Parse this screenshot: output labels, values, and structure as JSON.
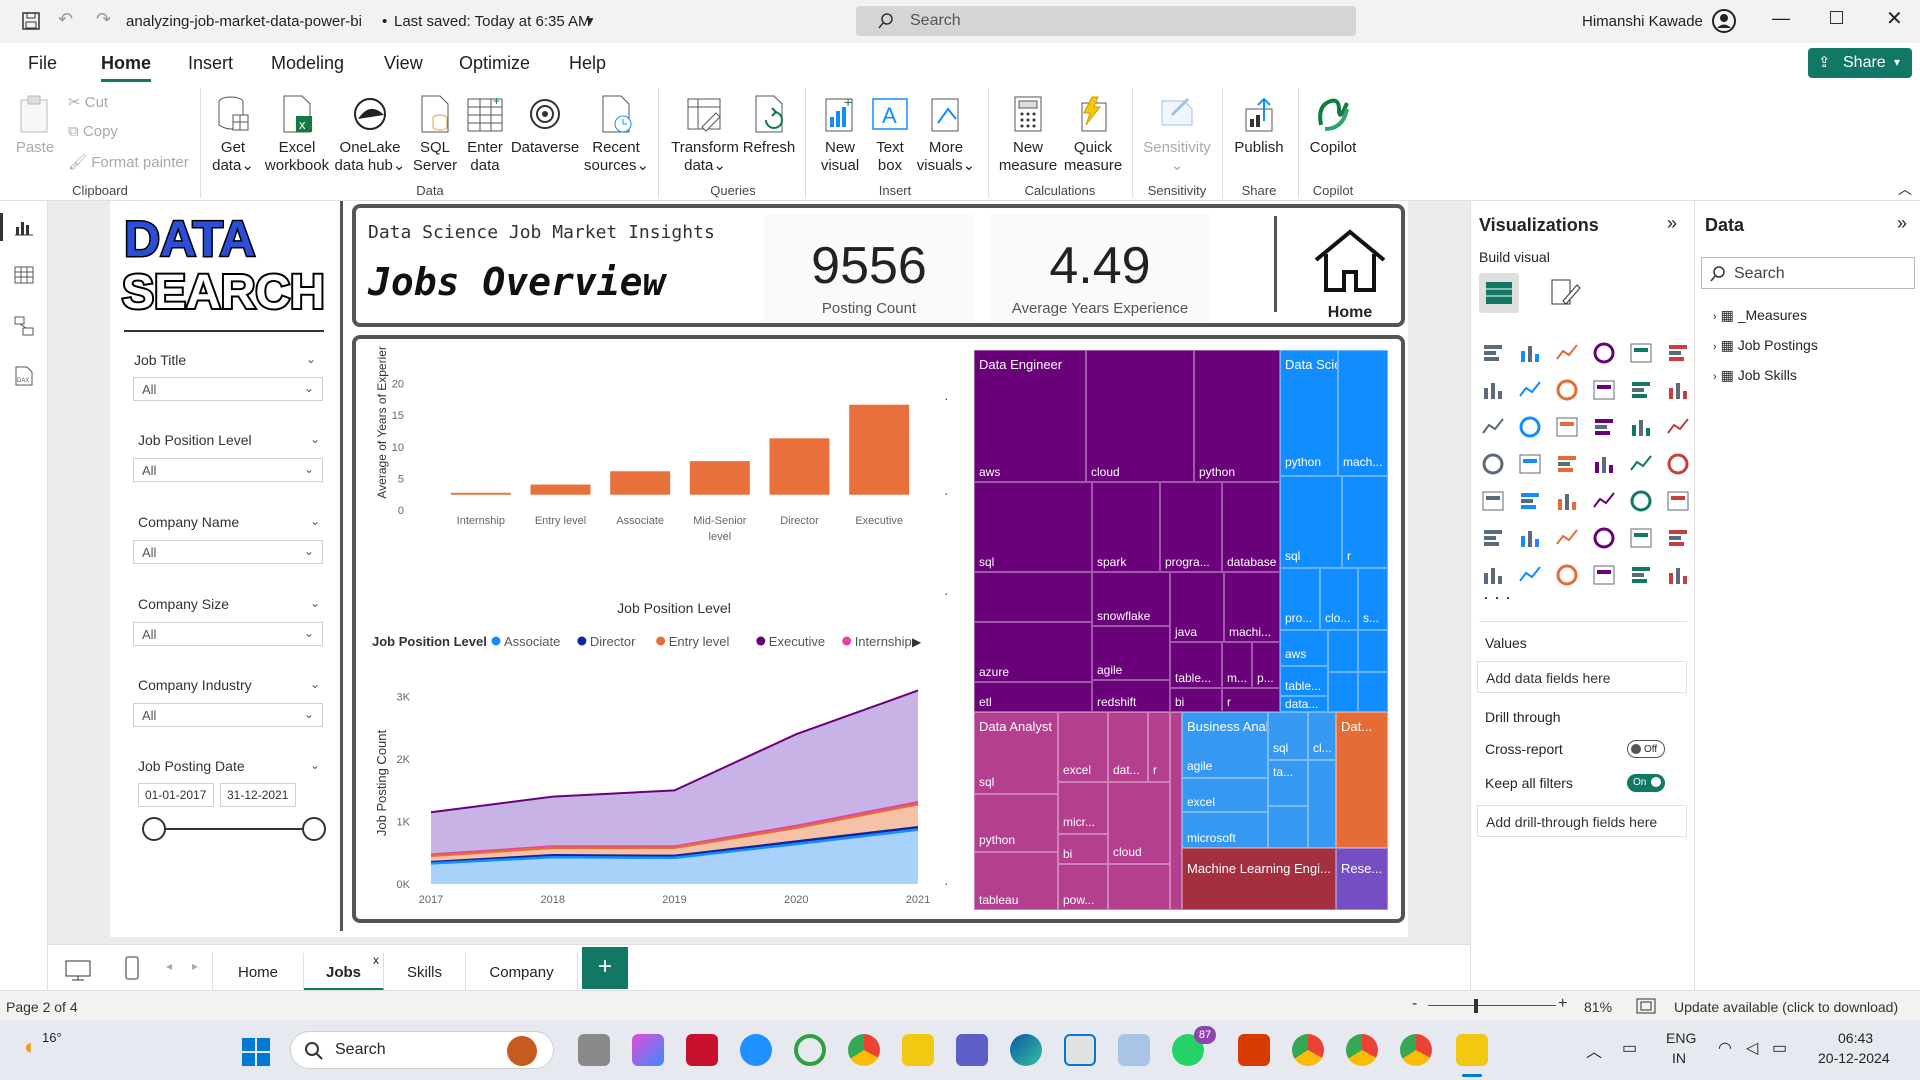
{
  "titlebar": {
    "filename": "analyzing-job-market-data-power-bi",
    "saved": "Last saved: Today at 6:35 AM",
    "search_placeholder": "Search",
    "user": "Himanshi Kawade"
  },
  "menu": [
    "File",
    "Home",
    "Insert",
    "Modeling",
    "View",
    "Optimize",
    "Help"
  ],
  "share_label": "Share",
  "ribbon": {
    "clipboard": {
      "paste": "Paste",
      "cut": "Cut",
      "copy": "Copy",
      "format": "Format painter",
      "group": "Clipboard"
    },
    "data": {
      "get": "Get",
      "get2": "data",
      "excel": "Excel",
      "excel2": "workbook",
      "onelake": "OneLake",
      "onelake2": "data hub",
      "sql": "SQL",
      "sql2": "Server",
      "enter": "Enter",
      "enter2": "data",
      "dataverse": "Dataverse",
      "recent": "Recent",
      "recent2": "sources",
      "group": "Data"
    },
    "queries": {
      "transform": "Transform",
      "transform2": "data",
      "refresh": "Refresh",
      "group": "Queries"
    },
    "insert": {
      "newvisual": "New",
      "newvisual2": "visual",
      "textbox": "Text",
      "textbox2": "box",
      "more": "More",
      "more2": "visuals",
      "group": "Insert"
    },
    "calculations": {
      "newmeasure": "New",
      "newmeasure2": "measure",
      "quick": "Quick",
      "quick2": "measure",
      "group": "Calculations"
    },
    "sensitivity": {
      "label": "Sensitivity",
      "group": "Sensitivity"
    },
    "share": {
      "publish": "Publish",
      "group": "Share"
    },
    "copilot": {
      "label": "Copilot",
      "group": "Copilot"
    }
  },
  "report": {
    "logo_line1": "DATA",
    "logo_line2": "SEARCH",
    "subtitle": "Data Science Job Market Insights",
    "title": "Jobs Overview",
    "kpi1_value": "9556",
    "kpi1_label": "Posting Count",
    "kpi2_value": "4.49",
    "kpi2_label": "Average Years Experience",
    "home_label": "Home",
    "slicers": [
      {
        "label": "Job Title",
        "value": "All"
      },
      {
        "label": "Job Position Level",
        "value": "All"
      },
      {
        "label": "Company Name",
        "value": "All"
      },
      {
        "label": "Company Size",
        "value": "All"
      },
      {
        "label": "Company Industry",
        "value": "All"
      }
    ],
    "date_slicer": {
      "label": "Job Posting Date",
      "start": "01-01-2017",
      "end": "31-12-2021"
    }
  },
  "chart_data": [
    {
      "type": "bar",
      "categories": [
        "Internship",
        "Entry level",
        "Associate",
        "Mid-Senior level",
        "Director",
        "Executive"
      ],
      "values": [
        0.3,
        1.6,
        3.7,
        5.3,
        8.9,
        14.2
      ],
      "xlabel": "Job Position Level",
      "ylabel": "Average of Years of Experien...",
      "yticks": [
        0,
        5,
        10,
        15,
        20
      ],
      "ylim": [
        0,
        20
      ],
      "color": "#e8703a"
    },
    {
      "type": "area",
      "legend_title": "Job Position Level",
      "x": [
        "2017",
        "2018",
        "2019",
        "2020",
        "2021"
      ],
      "ylabel": "Job Posting Count",
      "yticks": [
        "0K",
        "1K",
        "2K",
        "3K"
      ],
      "ylim": [
        0,
        3000
      ],
      "series": [
        {
          "name": "Associate",
          "color": "#118dff",
          "values": [
            330,
            430,
            420,
            640,
            870
          ]
        },
        {
          "name": "Director",
          "color": "#12239e",
          "values": [
            350,
            460,
            450,
            680,
            910
          ]
        },
        {
          "name": "Entry level",
          "color": "#e66c37",
          "values": [
            450,
            580,
            580,
            900,
            1280
          ]
        },
        {
          "name": "Executive",
          "color": "#6b007b",
          "values": [
            1150,
            1400,
            1500,
            2400,
            3100
          ]
        },
        {
          "name": "Internship",
          "color": "#e044a7",
          "values": [
            470,
            600,
            600,
            930,
            1310
          ]
        }
      ]
    }
  ],
  "treemap": {
    "groups": [
      {
        "name": "Data Engineer",
        "color": "#6b007b",
        "items": [
          "aws",
          "cloud",
          "python",
          "sql",
          "spark",
          "progra...",
          "database",
          "snowflake",
          "java",
          "machi...",
          "agile",
          "table...",
          "azure",
          "m...",
          "p...",
          "etl",
          "redshift",
          "bi",
          "r"
        ]
      },
      {
        "name": "Data Scientist",
        "color": "#118dff",
        "items": [
          "python",
          "mach...",
          "sql",
          "r",
          "pro...",
          "clo...",
          "s...",
          "aws",
          "table...",
          "data..."
        ]
      },
      {
        "name": "Data Analyst",
        "color": "#b43f8e",
        "items": [
          "sql",
          "excel",
          "dat...",
          "r",
          "python",
          "micr...",
          "bi",
          "cloud",
          "tableau",
          "pow..."
        ]
      },
      {
        "name": "Business Analyst",
        "color": "#3599f3",
        "items": [
          "agile",
          "sql",
          "cl...",
          "ta...",
          "excel",
          "microsoft"
        ]
      },
      {
        "name": "Dat...",
        "color": "#e66c37",
        "items": []
      },
      {
        "name": "Machine Learning Engi...",
        "color": "#a4303f",
        "items": []
      },
      {
        "name": "Rese...",
        "color": "#744ec2",
        "items": []
      }
    ]
  },
  "viz_pane": {
    "title": "Visualizations",
    "build": "Build visual",
    "values": "Values",
    "add_fields": "Add data fields here",
    "drill": "Drill through",
    "cross": "Cross-report",
    "cross_state": "Off",
    "keep": "Keep all filters",
    "keep_state": "On",
    "add_drill": "Add drill-through fields here"
  },
  "data_pane": {
    "title": "Data",
    "search": "Search",
    "tables": [
      "_Measures",
      "Job Postings",
      "Job Skills"
    ]
  },
  "tabs": [
    "Home",
    "Jobs",
    "Skills",
    "Company"
  ],
  "status": {
    "page": "Page 2 of 4",
    "zoom": "81%",
    "update": "Update available (click to download)"
  },
  "taskbar": {
    "temp": "16°",
    "search": "Search",
    "lang1": "ENG",
    "lang2": "IN",
    "time": "06:43",
    "date": "20-12-2024",
    "badge": "87"
  }
}
